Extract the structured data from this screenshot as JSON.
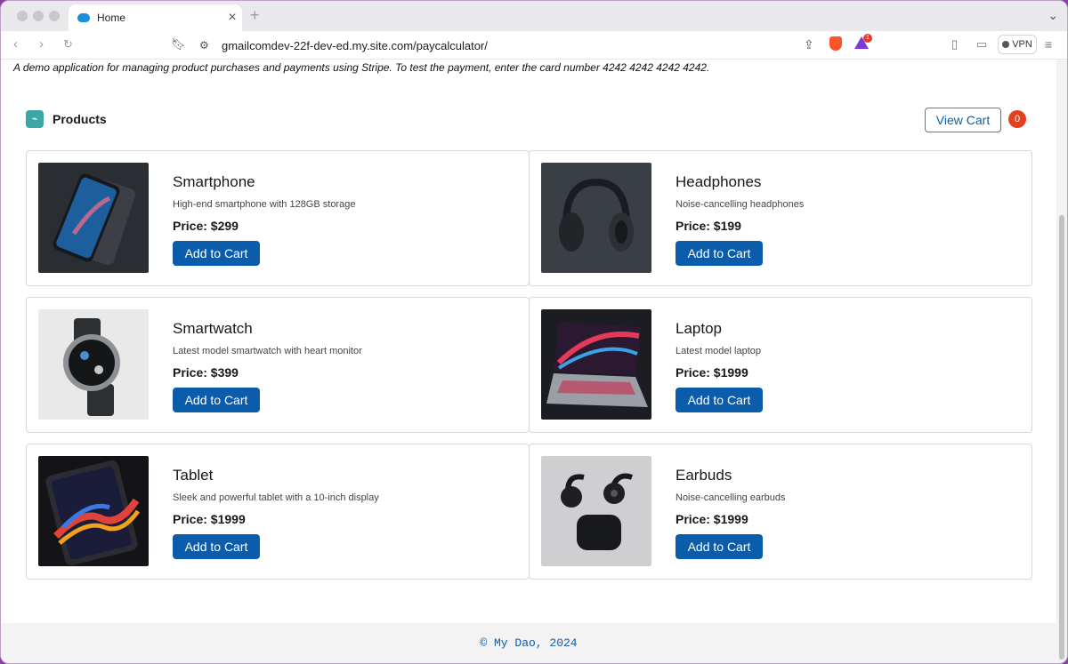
{
  "browser": {
    "tab_title": "Home",
    "tab_close": "×",
    "new_tab": "+",
    "url": "gmailcomdev-22f-dev-ed.my.site.com/paycalculator/",
    "vpn_label": "VPN",
    "rewards_badge": "1"
  },
  "page": {
    "description": "A demo application for managing product purchases and payments using Stripe. To test the payment, enter the card number 4242 4242 4242 4242.",
    "products_title": "Products",
    "view_cart_label": "View Cart",
    "cart_count": "0",
    "add_to_cart_label": "Add to Cart",
    "footer": "© My Dao, 2024"
  },
  "products": [
    {
      "name": "Smartphone",
      "description": "High-end smartphone with 128GB storage",
      "price": "Price: $299"
    },
    {
      "name": "Headphones",
      "description": "Noise-cancelling headphones",
      "price": "Price: $199"
    },
    {
      "name": "Smartwatch",
      "description": "Latest model smartwatch with heart monitor",
      "price": "Price: $399"
    },
    {
      "name": "Laptop",
      "description": "Latest model laptop",
      "price": "Price: $1999"
    },
    {
      "name": "Tablet",
      "description": "Sleek and powerful tablet with a 10-inch display",
      "price": "Price: $1999"
    },
    {
      "name": "Earbuds",
      "description": "Noise-cancelling earbuds",
      "price": "Price: $1999"
    }
  ],
  "colors": {
    "brand_button": "#0b5cab",
    "cart_badge": "#e3401e",
    "product_icon": "#3aa6a6"
  }
}
